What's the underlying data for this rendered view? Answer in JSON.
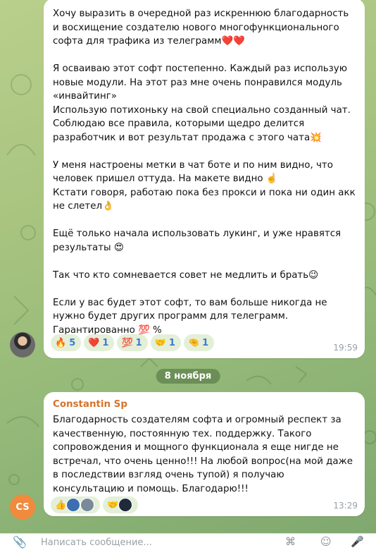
{
  "messages": [
    {
      "text": "Хочу выразить в очередной раз искреннюю благодарность и восхищение создателю нового многофункционального софта для трафика из телеграмм❤️❤️\n\nЯ осваиваю этот софт постепенно. Каждый раз использую новые модули. На этот раз мне очень понравился модуль «инвайтинг»\nИспользую потихоньку на свой специально созданный чат. Соблюдаю все правила, которыми щедро делится разработчик и вот результат продажа с этого чата💥\n\nУ меня настроены метки в чат боте и по ним видно, что человек пришел оттуда. На макете видно ☝️\nКстати говоря, работаю пока без прокси и пока ни один акк не слетел👌\n\nЕщё только начала использовать лукинг, и уже нравятся результаты 😍\n\nТак что кто сомневается совет не медлить и брать😉\n\nЕсли у вас будет этот софт, то вам больше никогда не нужно будет других программ для телеграмм.\nГарантированно 💯 %",
      "time": "19:59",
      "reactions": [
        {
          "emoji": "🔥",
          "count": "5"
        },
        {
          "emoji": "❤️",
          "count": "1"
        },
        {
          "emoji": "💯",
          "count": "1"
        },
        {
          "emoji": "🤝",
          "count": "1"
        },
        {
          "emoji": "🤏",
          "count": "1"
        }
      ]
    },
    {
      "sender": "Constantin Sp",
      "avatar_initials": "CS",
      "text": "Благодарность создателям софта и огромный респект за качественную, постоянную тех. поддержку. Такого сопровождения и мощного функционала я еще нигде не встречал, что очень ценно!!! На любой вопрос(на мой даже в последствии взгляд очень тупой) я получаю консультацию и помощь. Благодарю!!!",
      "time": "13:29",
      "reactions": [
        {
          "emoji": "👍"
        },
        {
          "emoji": "🤝"
        }
      ]
    }
  ],
  "date_separator": "8 ноября",
  "composer": {
    "placeholder": "Написать сообщение..."
  },
  "colors": {
    "accent": "#3a7bd5",
    "sender_name": "#d6732c",
    "cs_avatar": "#f08a3d"
  }
}
